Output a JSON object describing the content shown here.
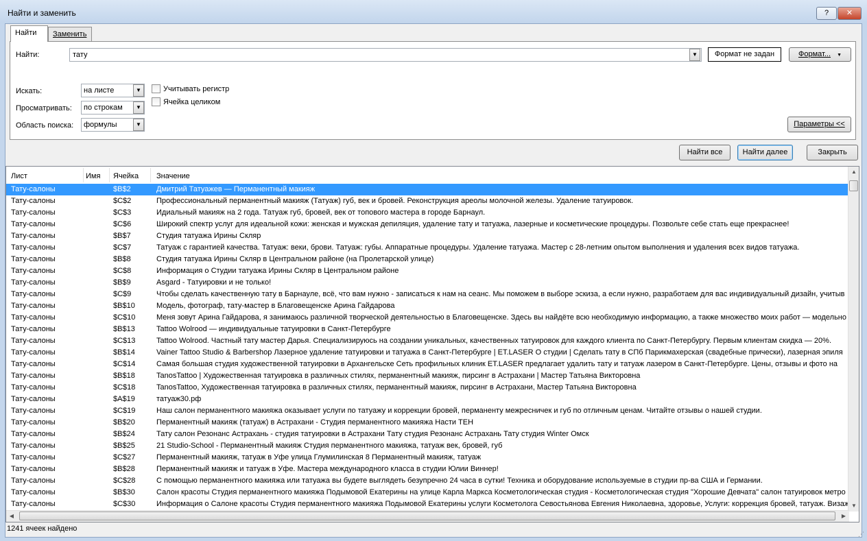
{
  "window": {
    "title": "Найти и заменить",
    "help_label": "?",
    "close_label": "✕"
  },
  "tabs": [
    {
      "label": "Найти",
      "active": true
    },
    {
      "label": "Заменить",
      "active": false
    }
  ],
  "find": {
    "label": "Найти:",
    "value": "тату",
    "format_status": "Формат не задан",
    "format_button": "Формат...",
    "dropdown_arrow": "▼"
  },
  "options": {
    "within_label": "Искать:",
    "within_value": "на листе",
    "search_label": "Просматривать:",
    "search_value": "по строкам",
    "lookin_label": "Область поиска:",
    "lookin_value": "формулы",
    "match_case_label": "Учитывать регистр",
    "match_case_checked": false,
    "entire_cell_label": "Ячейка целиком",
    "entire_cell_checked": false,
    "params_button": "Параметры <<"
  },
  "actions": {
    "find_all": "Найти все",
    "find_next": "Найти далее",
    "close": "Закрыть"
  },
  "results": {
    "columns": [
      "Лист",
      "Имя",
      "Ячейка",
      "Значение"
    ],
    "rows": [
      {
        "sheet": "Тату-салоны",
        "name": "",
        "cell": "$B$2",
        "value": "Дмитрий Татуажев — Перманентный макияж",
        "selected": true
      },
      {
        "sheet": "Тату-салоны",
        "name": "",
        "cell": "$C$2",
        "value": "Профессиональный перманентный макияж (Татуаж) губ, век и бровей. Реконструкция ареолы молочной железы. Удаление татуировок."
      },
      {
        "sheet": "Тату-салоны",
        "name": "",
        "cell": "$C$3",
        "value": "Идиальный макияж на 2 года. Татуаж губ, бровей, век от топового мастера в городе Барнаул."
      },
      {
        "sheet": "Тату-салоны",
        "name": "",
        "cell": "$C$6",
        "value": "Широкий спектр услуг для идеальной кожи: женская и мужская депиляция, удаление тату и татуажа, лазерные и косметические процедуры. Позвольте себе стать еще прекраснее!"
      },
      {
        "sheet": "Тату-салоны",
        "name": "",
        "cell": "$B$7",
        "value": "Студия татуажа Ирины Скляр"
      },
      {
        "sheet": "Тату-салоны",
        "name": "",
        "cell": "$C$7",
        "value": "Татуаж с гарантией качества. Татуаж: веки, брови. Татуаж: губы. Аппаратные процедуры. Удаление татуажа. Мастер с 28-летним опытом выполнения и удаления всех видов татуажа."
      },
      {
        "sheet": "Тату-салоны",
        "name": "",
        "cell": "$B$8",
        "value": "Студия татуажа Ирины Скляр в Центральном районе (на Пролетарской улице)"
      },
      {
        "sheet": "Тату-салоны",
        "name": "",
        "cell": "$C$8",
        "value": "Информация о Студии татуажа Ирины Скляр в Центральном районе"
      },
      {
        "sheet": "Тату-салоны",
        "name": "",
        "cell": "$B$9",
        "value": "Asgard - Татуировки и не только!"
      },
      {
        "sheet": "Тату-салоны",
        "name": "",
        "cell": "$C$9",
        "value": "Чтобы сделать качественную тату в Барнауле, всё, что вам нужно - записаться к нам на сеанс. Мы поможем в выборе эскиза, а если нужно, разработаем для вас индивидуальный дизайн, учитыв"
      },
      {
        "sheet": "Тату-салоны",
        "name": "",
        "cell": "$B$10",
        "value": "Модель, фотограф, тату-мастер в Благовещенске Арина Гайдарова"
      },
      {
        "sheet": "Тату-салоны",
        "name": "",
        "cell": "$C$10",
        "value": "Меня зовут Арина Гайдарова, я занимаюсь различной творческой деятельностью в Благовещенске. Здесь вы найдёте всю необходимую информацию, а также множество моих работ — модельно"
      },
      {
        "sheet": "Тату-салоны",
        "name": "",
        "cell": "$B$13",
        "value": "Tattoo Wolrood — индивидуальные татуировки в Санкт-Петербурге"
      },
      {
        "sheet": "Тату-салоны",
        "name": "",
        "cell": "$C$13",
        "value": "Tattoo Wolrood. Частный тату мастер Дарья. Специализируюсь на создании уникальных, качественных татуировок для каждого клиента по Санкт-Петербургу. Первым клиентам скидка — 20%."
      },
      {
        "sheet": "Тату-салоны",
        "name": "",
        "cell": "$B$14",
        "value": "Vainer Tattoo Studio & Barbershop Лазерное удаление татуировки и татуажа в Санкт-Петербурге | ET.LASER О студии | Сделать тату в СПб Парикмахерская (свадебные прически), лазерная эпиля"
      },
      {
        "sheet": "Тату-салоны",
        "name": "",
        "cell": "$C$14",
        "value": "Самая большая студия художественной татуировки в Архангельске Сеть профильных клиник ET.LASER предлагает удалить тату и татуаж лазером в Санкт-Петербурге. Цены, отзывы и фото на"
      },
      {
        "sheet": "Тату-салоны",
        "name": "",
        "cell": "$B$18",
        "value": "TanosTattoo | Художественная татуировка в различных стилях, перманентный макияж, пирсинг в Астрахани | Мастер Татьяна Викторовна"
      },
      {
        "sheet": "Тату-салоны",
        "name": "",
        "cell": "$C$18",
        "value": "TanosTattoo, Художественная татуировка в различных стилях, перманентный макияж, пирсинг в Астрахани, Мастер Татьяна Викторовна"
      },
      {
        "sheet": "Тату-салоны",
        "name": "",
        "cell": "$A$19",
        "value": "татуаж30.рф"
      },
      {
        "sheet": "Тату-салоны",
        "name": "",
        "cell": "$C$19",
        "value": "Наш салон перманентного макияжа оказывает услуги по татуажу и коррекции бровей, перманенту межресничек и губ по отличным ценам. Читайте отзывы о нашей студии."
      },
      {
        "sheet": "Тату-салоны",
        "name": "",
        "cell": "$B$20",
        "value": "Перманентный макияж (татуаж) в Астрахани - Студия перманентного макияжа Насти ТЕН"
      },
      {
        "sheet": "Тату-салоны",
        "name": "",
        "cell": "$B$24",
        "value": "Тату салон Резонанс Астрахань - студия татуировки в Астрахани Тату студия Резонанс Астрахань Тату студия Winter Омск"
      },
      {
        "sheet": "Тату-салоны",
        "name": "",
        "cell": "$B$25",
        "value": "21 Studio-School - Перманентный макияж Студия перманентного макияжа, татуаж век, бровей, губ"
      },
      {
        "sheet": "Тату-салоны",
        "name": "",
        "cell": "$C$27",
        "value": "Перманентный макияж, татуаж в Уфе улица Глумилинская 8 Перманентный макияж, татуаж"
      },
      {
        "sheet": "Тату-салоны",
        "name": "",
        "cell": "$B$28",
        "value": "Перманентный макияж и татуаж в Уфе. Мастера международного класса в студии Юлии Виннер!"
      },
      {
        "sheet": "Тату-салоны",
        "name": "",
        "cell": "$C$28",
        "value": "С помощью перманентного макияжа или татуажа вы будете выглядеть безупречно 24 часа в сутки! Техника и оборудование используемые в студии пр-ва США и Германии."
      },
      {
        "sheet": "Тату-салоны",
        "name": "",
        "cell": "$B$30",
        "value": "Салон красоты Студия перманентного макияжа Подымовой Екатерины на улице Карла Маркса Косметологическая студия - Косметологическая студия \"Хорошие Девчата\" салон татуировок метро"
      },
      {
        "sheet": "Тату-салоны",
        "name": "",
        "cell": "$C$30",
        "value": "Информация о Салоне красоты Студия перманентного макияжа Подымовой Екатерины услуги Косметолога Севостьянова Евгения Николаевна, здоровье, Услуги: коррекция бровей, татуаж. Визаж"
      }
    ]
  },
  "status": "1241 ячеек найдено",
  "icons": {
    "scroll_up": "▲",
    "scroll_down": "▼",
    "scroll_left": "◀",
    "scroll_right": "▶",
    "grip": "⋰"
  },
  "colors": {
    "selection": "#3399ff",
    "title_bar": "#c2d5ec",
    "close_button": "#c4452b"
  }
}
